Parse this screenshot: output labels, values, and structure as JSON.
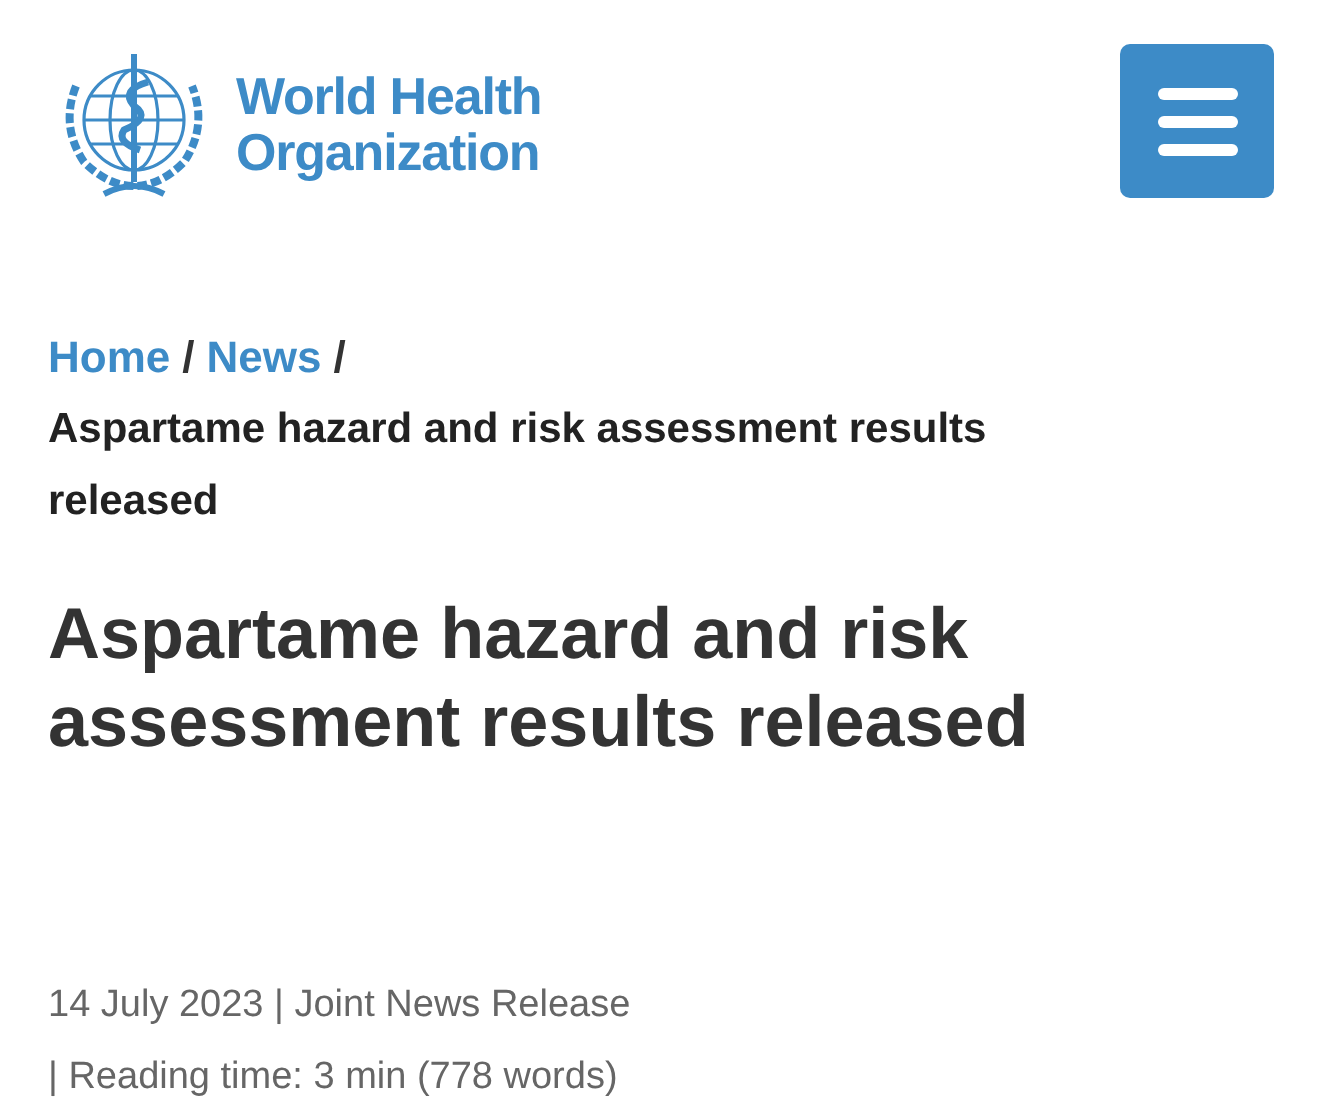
{
  "header": {
    "logo_lines": [
      "World Health",
      "Organization"
    ]
  },
  "breadcrumb": {
    "links": [
      {
        "label": "Home",
        "separator": "/"
      },
      {
        "label": "News",
        "separator": "/"
      }
    ],
    "current": "Aspartame hazard and risk assessment results released"
  },
  "article": {
    "title": "Aspartame hazard and risk assessment results released",
    "meta_lines": [
      "14 July 2023 | Joint News Release",
      "| Reading time: 3 min (778 words)"
    ]
  }
}
